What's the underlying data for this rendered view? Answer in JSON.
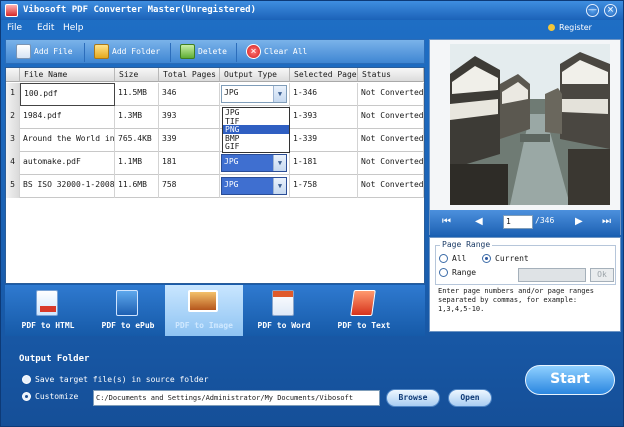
{
  "window": {
    "title": "Vibosoft PDF Converter Master(Unregistered)",
    "minimize_glyph": "—",
    "close_glyph": "×"
  },
  "menu": {
    "items": [
      "File",
      "Edit",
      "Help"
    ],
    "register_label": "Register"
  },
  "toolbar": {
    "add_file": "Add File",
    "add_folder": "Add Folder",
    "delete": "Delete",
    "clear_all": "Clear All"
  },
  "table": {
    "columns": [
      "File Name",
      "Size",
      "Total Pages",
      "Output Type",
      "Selected Page",
      "Status"
    ],
    "rows": [
      {
        "num": "1",
        "name": "100.pdf",
        "size": "11.5MB",
        "pages": "346",
        "type": "JPG",
        "selected": "1-346",
        "status": "Not Converted"
      },
      {
        "num": "2",
        "name": "1984.pdf",
        "size": "1.3MB",
        "pages": "393",
        "type": "JPG",
        "selected": "1-393",
        "status": "Not Converted"
      },
      {
        "num": "3",
        "name": "Around the World in",
        "size": "765.4KB",
        "pages": "339",
        "type": "PNG",
        "selected": "1-339",
        "status": "Not Converted"
      },
      {
        "num": "4",
        "name": "automake.pdF",
        "size": "1.1MB",
        "pages": "181",
        "type": "JPG",
        "selected": "1-181",
        "status": "Not Converted"
      },
      {
        "num": "5",
        "name": "BS ISO 32000-1-2008",
        "size": "11.6MB",
        "pages": "758",
        "type": "JPG",
        "selected": "1-758",
        "status": "Not Converted"
      }
    ],
    "dropdown_options": [
      "JPG",
      "TIF",
      "PNG",
      "BMP",
      "GIF"
    ],
    "dropdown_highlighted": "PNG"
  },
  "preview": {
    "current_page": "1",
    "total_pages": "/346",
    "first_glyph": "⏮",
    "prev_glyph": "◀",
    "next_glyph": "▶",
    "last_glyph": "⏭"
  },
  "page_range": {
    "legend": "Page Range",
    "all": "All",
    "current": "Current",
    "range": "Range",
    "ok": "Ok",
    "hint": "Enter page numbers and/or page ranges\nseparated by commas, for example:\n1,3,4,5-10."
  },
  "tabs": [
    {
      "label": "PDF to HTML",
      "icon": "html-icon",
      "color": "#d93a2b"
    },
    {
      "label": "PDF to ePub",
      "icon": "epub-icon",
      "color": "#3a86d8"
    },
    {
      "label": "PDF to Image",
      "icon": "image-icon",
      "color": "#c97a2a"
    },
    {
      "label": "PDF to Word",
      "icon": "word-icon",
      "color": "#2f63b8"
    },
    {
      "label": "PDF to Text",
      "icon": "text-icon",
      "color": "#e2462e"
    }
  ],
  "output": {
    "title": "Output Folder",
    "option_source": "Save target file(s) in source folder",
    "option_custom": "Customize",
    "path": "C:/Documents and Settings/Administrator/My Documents/Vibosoft",
    "browse": "Browse",
    "open": "Open",
    "start": "Start"
  }
}
